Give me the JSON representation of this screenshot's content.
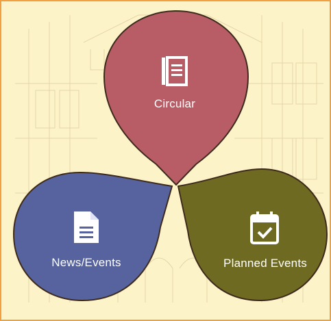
{
  "menu": {
    "items": [
      {
        "id": "circular",
        "label": "Circular",
        "icon": "notebook-icon",
        "color": "#b85c66"
      },
      {
        "id": "news-events",
        "label": "News/Events",
        "icon": "document-icon",
        "color": "#56639e"
      },
      {
        "id": "planned-events",
        "label": "Planned Events",
        "icon": "calendar-check-icon",
        "color": "#6f6a22"
      }
    ]
  },
  "theme": {
    "background": "#fdf3c8",
    "border": "#f0a040",
    "outline": "#3d2a1c"
  }
}
